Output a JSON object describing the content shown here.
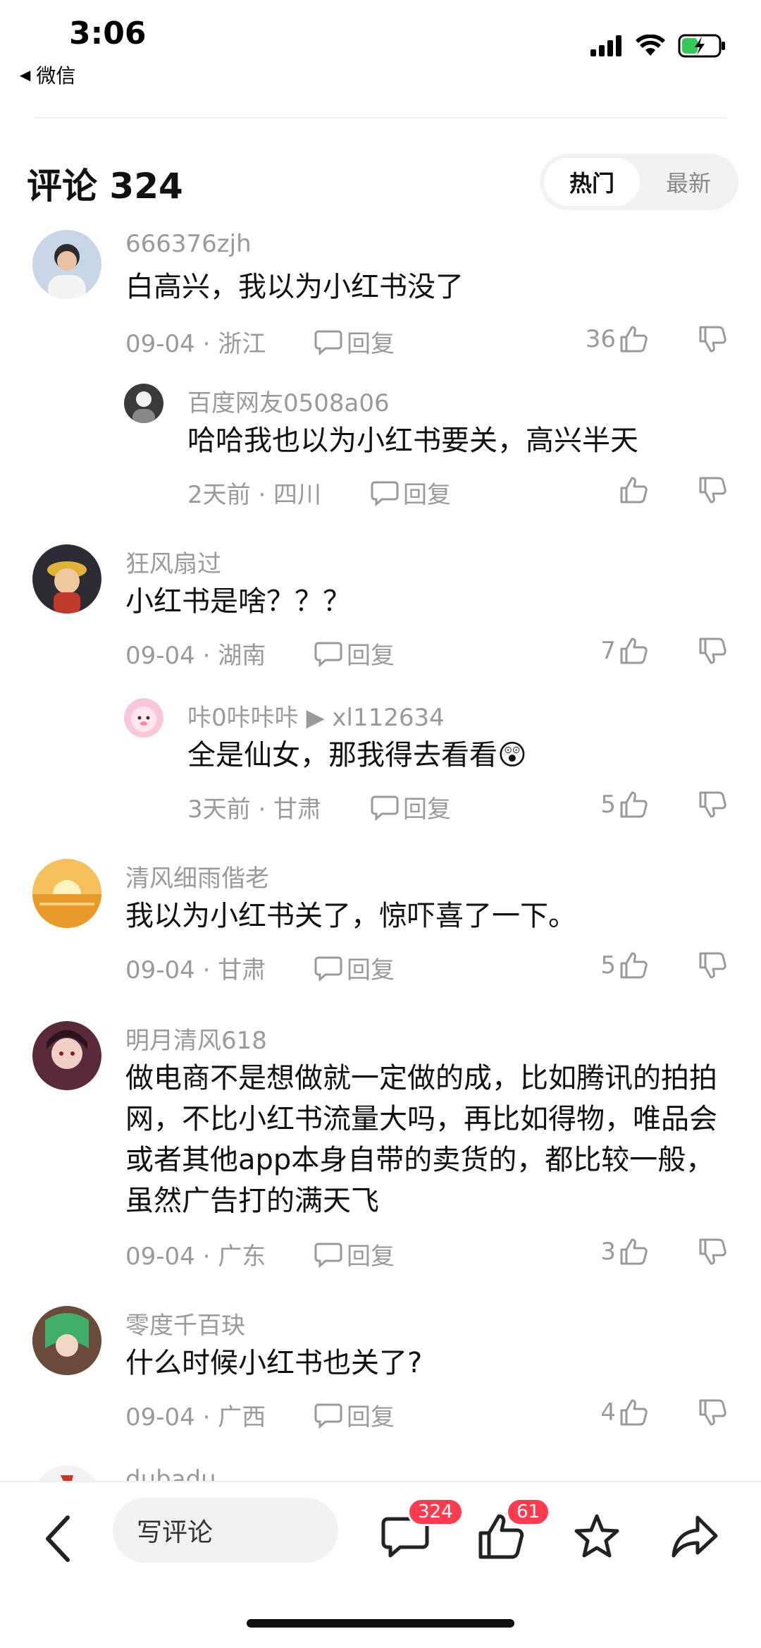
{
  "status_bar": {
    "time": "3:06",
    "back_app": "微信"
  },
  "header": {
    "title": "评论 324",
    "sort_hot": "热门",
    "sort_new": "最新"
  },
  "comments": [
    {
      "user": "666376zjh",
      "text": "白高兴，我以为小红书没了",
      "meta": "09-04 · 浙江",
      "reply_label": "回复",
      "likes": "36",
      "avatar_color": "#c9d6e8"
    },
    {
      "user": "百度网友0508a06",
      "text": "哈哈我也以为小红书要关，高兴半天",
      "meta": "2天前 · 四川",
      "reply_label": "回复",
      "likes": "",
      "avatar_color": "#3a3a3a"
    },
    {
      "user": "狂风扇过",
      "text": "小红书是啥？？？",
      "meta": "09-04 · 湖南",
      "reply_label": "回复",
      "likes": "7",
      "avatar_color": "#2d2b33"
    },
    {
      "user": "咔0咔咔咔 ▶ xl112634",
      "text": "全是仙女，那我得去看看😲",
      "meta": "3天前 · 甘肃",
      "reply_label": "回复",
      "likes": "5",
      "avatar_color": "#f7c8dc"
    },
    {
      "user": "清风细雨偕老",
      "text": "我以为小红书关了，惊吓喜了一下。",
      "meta": "09-04 · 甘肃",
      "reply_label": "回复",
      "likes": "5",
      "avatar_color": "#f0a93a"
    },
    {
      "user": "明月清风618",
      "text": "做电商不是想做就一定做的成，比如腾讯的拍拍网，不比小红书流量大吗，再比如得物，唯品会或者其他app本身自带的卖货的，都比较一般，虽然广告打的满天飞",
      "meta": "09-04 · 广东",
      "reply_label": "回复",
      "likes": "3",
      "avatar_color": "#5a2a3a"
    },
    {
      "user": "零度千百玦",
      "text": "什么时候小红书也关了?",
      "meta": "09-04 · 广西",
      "reply_label": "回复",
      "likes": "4",
      "avatar_color": "#5f7f5a"
    },
    {
      "user": "dubadu",
      "avatar_color": "#c0392b"
    }
  ],
  "bottom_bar": {
    "write_placeholder": "写评论",
    "comment_count": "324",
    "like_count": "61"
  }
}
